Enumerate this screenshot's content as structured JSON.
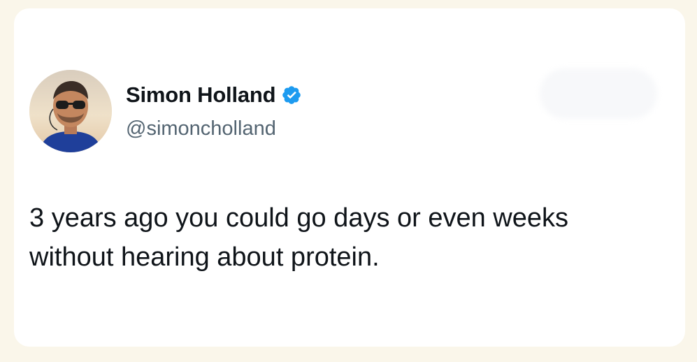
{
  "author": {
    "display_name": "Simon Holland",
    "handle": "@simoncholland",
    "verified": true,
    "verified_color": "#1d9bf0"
  },
  "tweet": {
    "text": "3 years ago you could go days or even weeks without hearing about protein."
  },
  "icons": {
    "verified": "verified-badge-icon",
    "avatar": "profile-photo"
  },
  "colors": {
    "background": "#faf6ea",
    "card": "#ffffff",
    "text": "#0f1419",
    "secondary_text": "#536471"
  }
}
